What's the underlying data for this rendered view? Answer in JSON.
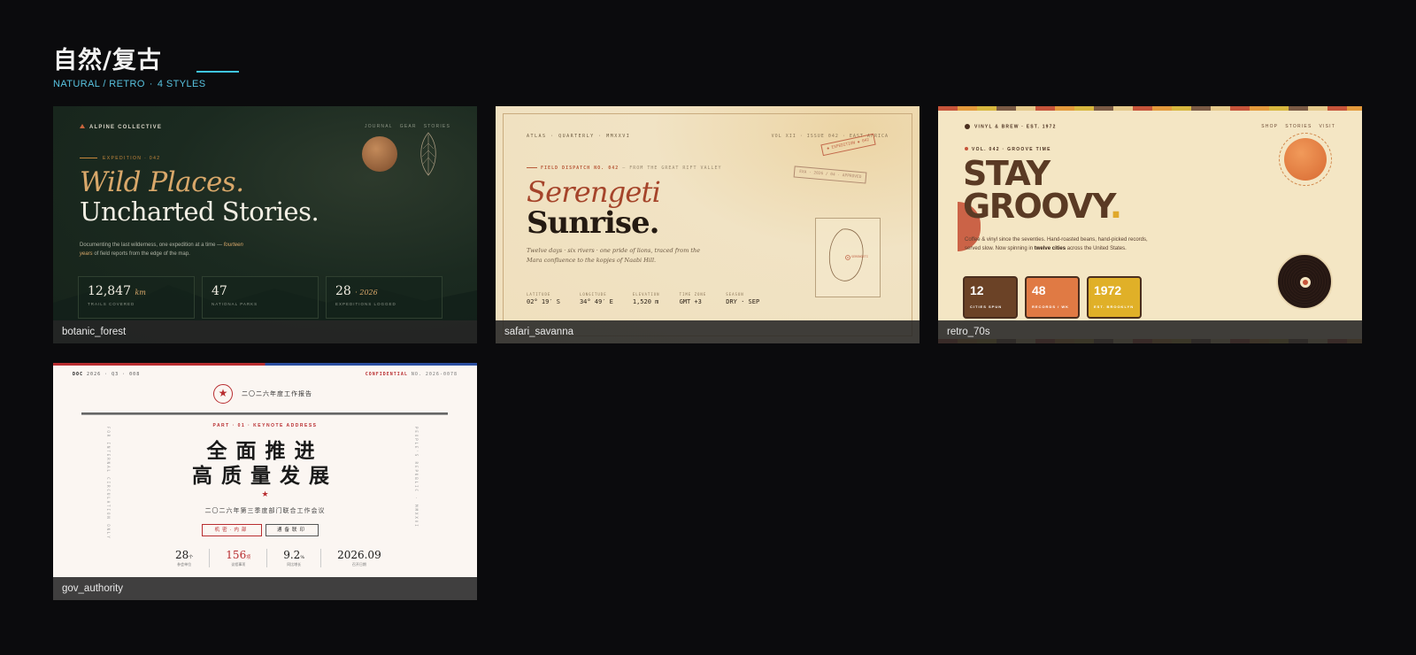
{
  "header": {
    "title": "自然/复古",
    "subtitle": "NATURAL / RETRO",
    "count": "4 STYLES",
    "accent": "#3fc6e6"
  },
  "cards": [
    {
      "label": "botanic_forest",
      "brand": "ALPINE COLLECTIVE",
      "nav": [
        "JOURNAL",
        "GEAR",
        "STORIES"
      ],
      "eyebrow": "EXPEDITION · 042",
      "headline_1": "Wild Places.",
      "headline_2": "Uncharted Stories.",
      "desc_pre": "Documenting the last wilderness, one expedition at a time —",
      "desc_em": "fourteen years",
      "desc_post": "of field reports from the edge of the map.",
      "stats": [
        {
          "value": "12,847",
          "unit": "km",
          "label": "TRAILS COVERED"
        },
        {
          "value": "47",
          "unit": "",
          "label": "NATIONAL PARKS"
        },
        {
          "value": "28",
          "unit": "· 2026",
          "label": "EXPEDITIONS LOGGED"
        }
      ]
    },
    {
      "label": "safari_savanna",
      "top_left": "ATLAS · QUARTERLY · MMXXVI",
      "top_right": "VOL XII · ISSUE 042 · EAST AFRICA",
      "dispatch": "FIELD DISPATCH NO. 042",
      "dispatch_from": "— FROM THE GREAT RIFT VALLEY",
      "headline_1": "Serengeti",
      "headline_2": "Sunrise.",
      "desc": "Twelve days · six rivers · one pride of lions, traced from the Mara confluence to the kopjes of Naabi Hill.",
      "stamp_1": "◆ EXPEDITION ◆ 042",
      "stamp_2": "EXA · 2026 / 04 · APPROVED",
      "map_label": "SERENGETI",
      "coords": [
        {
          "key": "LATITUDE",
          "value": "02° 19′ S"
        },
        {
          "key": "LONGITUDE",
          "value": "34° 49′ E"
        },
        {
          "key": "ELEVATION",
          "value": "1,520 m"
        },
        {
          "key": "TIME ZONE",
          "value": "GMT +3"
        },
        {
          "key": "SEASON",
          "value": "DRY · SEP"
        }
      ]
    },
    {
      "label": "retro_70s",
      "brand": "VINYL & BREW · EST. 1972",
      "nav": [
        "SHOP",
        "STORIES",
        "VISIT"
      ],
      "vol": "VOL. 042 · GROOVE TIME",
      "headline_1": "STAY",
      "headline_2": "GROOVY",
      "headline_dot": ".",
      "desc_pre": "Coffee & vinyl since the seventies. Hand-roasted beans, hand-picked records, served slow. Now spinning in",
      "desc_bold": "twelve cities",
      "desc_post": "across the United States.",
      "stats": [
        {
          "value": "12",
          "label": "CITIES SPUN",
          "color": "#6b4226"
        },
        {
          "value": "48",
          "label": "RECORDS / WK",
          "color": "#e07a44"
        },
        {
          "value": "1972",
          "label": "EST. BROOKLYN",
          "color": "#e0b028"
        }
      ]
    },
    {
      "label": "gov_authority",
      "doc": "DOC",
      "doc_meta": "2026 · Q3 · 008",
      "confidential": "CONFIDENTIAL",
      "confidential_no": "NO. 2026-0078",
      "report": "二〇二六年度工作报告",
      "part": "PART · 01 · KEYNOTE ADDRESS",
      "headline_1": "全面推进",
      "headline_2": "高质量发展",
      "meeting": "二〇二六年第三季度部门联合工作会议",
      "btn_1": "机密·内部",
      "btn_2": "通备联印",
      "side_left": "FOR INTERNAL CIRCULATION ONLY",
      "side_right": "PEOPLE'S REPUBLIC · MMXXVI",
      "stats": [
        {
          "value": "28",
          "unit": "个",
          "label": "参会单位",
          "red": false
        },
        {
          "value": "156",
          "unit": "项",
          "label": "议程事项",
          "red": true
        },
        {
          "value": "9.2",
          "unit": "%",
          "label": "同比增长",
          "red": false
        },
        {
          "value": "2026.09",
          "unit": "",
          "label": "召开日期",
          "red": false
        }
      ]
    }
  ]
}
